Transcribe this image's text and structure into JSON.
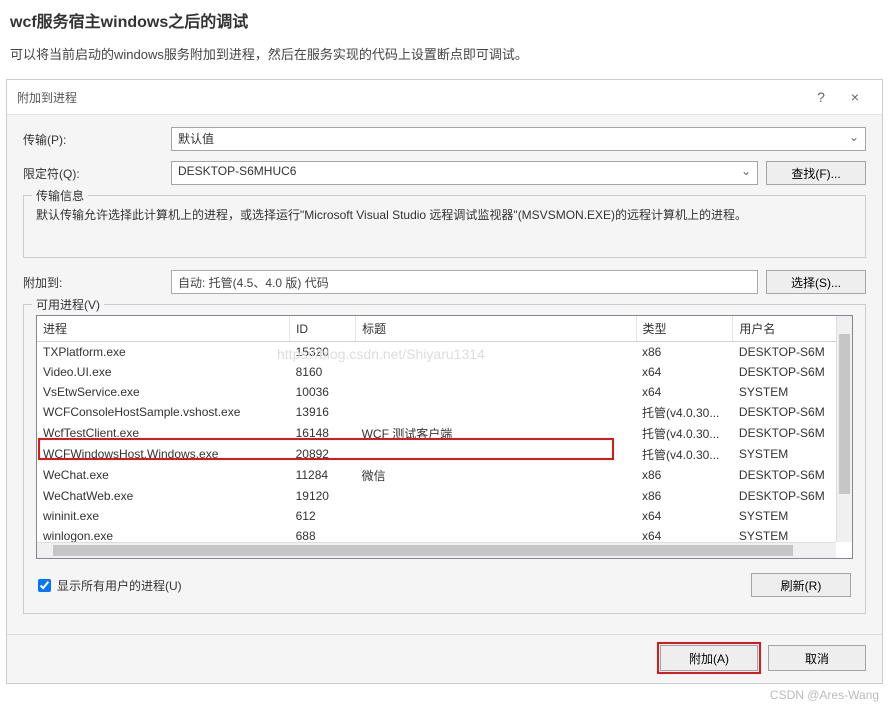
{
  "page": {
    "title": "wcf服务宿主windows之后的调试",
    "subtitle": "可以将当前启动的windows服务附加到进程，然后在服务实现的代码上设置断点即可调试。"
  },
  "dialog": {
    "title": "附加到进程",
    "help_icon": "?",
    "close_icon": "×"
  },
  "form": {
    "transport_label": "传输(P):",
    "transport_value": "默认值",
    "qualifier_label": "限定符(Q):",
    "qualifier_value": "DESKTOP-S6MHUC6",
    "find_btn": "查找(F)...",
    "transport_info_title": "传输信息",
    "transport_info_text": "默认传输允许选择此计算机上的进程，或选择运行\"Microsoft Visual Studio 远程调试监视器\"(MSVSMON.EXE)的远程计算机上的进程。",
    "attach_to_label": "附加到:",
    "attach_to_value": "自动: 托管(4.5、4.0 版) 代码",
    "select_btn": "选择(S)...",
    "available_processes_label": "可用进程(V)"
  },
  "table": {
    "headers": {
      "process": "进程",
      "id": "ID",
      "title": "标题",
      "type": "类型",
      "user": "用户名"
    },
    "rows": [
      {
        "process": "TXPlatform.exe",
        "id": "15320",
        "title": "",
        "type": "x86",
        "user": "DESKTOP-S6M"
      },
      {
        "process": "Video.UI.exe",
        "id": "8160",
        "title": "",
        "type": "x64",
        "user": "DESKTOP-S6M"
      },
      {
        "process": "VsEtwService.exe",
        "id": "10036",
        "title": "",
        "type": "x64",
        "user": "SYSTEM"
      },
      {
        "process": "WCFConsoleHostSample.vshost.exe",
        "id": "13916",
        "title": "",
        "type": "托管(v4.0.30...",
        "user": "DESKTOP-S6M"
      },
      {
        "process": "WcfTestClient.exe",
        "id": "16148",
        "title": "WCF 测试客户端",
        "type": "托管(v4.0.30...",
        "user": "DESKTOP-S6M"
      },
      {
        "process": "WCFWindowsHost.Windows.exe",
        "id": "20892",
        "title": "",
        "type": "托管(v4.0.30...",
        "user": "SYSTEM"
      },
      {
        "process": "WeChat.exe",
        "id": "11284",
        "title": "微信",
        "type": "x86",
        "user": "DESKTOP-S6M"
      },
      {
        "process": "WeChatWeb.exe",
        "id": "19120",
        "title": "",
        "type": "x86",
        "user": "DESKTOP-S6M"
      },
      {
        "process": "wininit.exe",
        "id": "612",
        "title": "",
        "type": "x64",
        "user": "SYSTEM"
      },
      {
        "process": "winlogon.exe",
        "id": "688",
        "title": "",
        "type": "x64",
        "user": "SYSTEM"
      }
    ]
  },
  "checkbox": {
    "show_all_users": "显示所有用户的进程(U)"
  },
  "buttons": {
    "refresh": "刷新(R)",
    "attach": "附加(A)",
    "cancel": "取消"
  },
  "watermark": "https://blog.csdn.net/Shiyaru1314",
  "csdn": "CSDN @Ares-Wang"
}
